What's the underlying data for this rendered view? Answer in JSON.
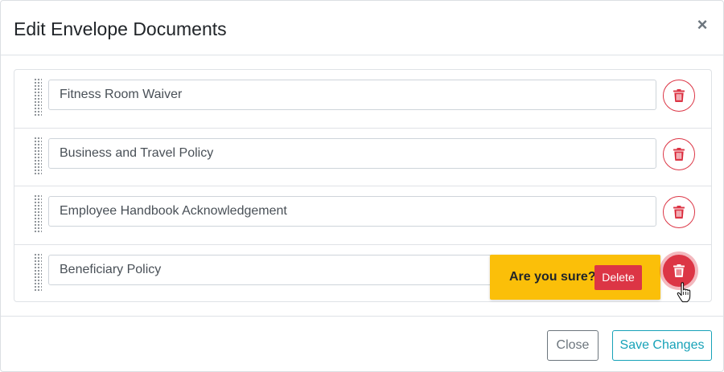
{
  "modal": {
    "title": "Edit Envelope Documents",
    "close_glyph": "×"
  },
  "documents": [
    {
      "name": "Fitness Room Waiver"
    },
    {
      "name": "Business and Travel Policy"
    },
    {
      "name": "Employee Handbook Acknowledgement"
    },
    {
      "name": "Beneficiary Policy"
    }
  ],
  "confirm": {
    "question": "Are you sure?",
    "delete_label": "Delete"
  },
  "footer": {
    "close_label": "Close",
    "save_label": "Save Changes"
  },
  "icons": {
    "row_delete": "trash-icon",
    "drag": "drag-handle-icon",
    "close": "close-icon",
    "cursor": "hand-pointer-icon"
  },
  "colors": {
    "danger": "#dc3545",
    "warning": "#fbbf09",
    "info": "#17a2b8",
    "secondary": "#6c757d"
  }
}
